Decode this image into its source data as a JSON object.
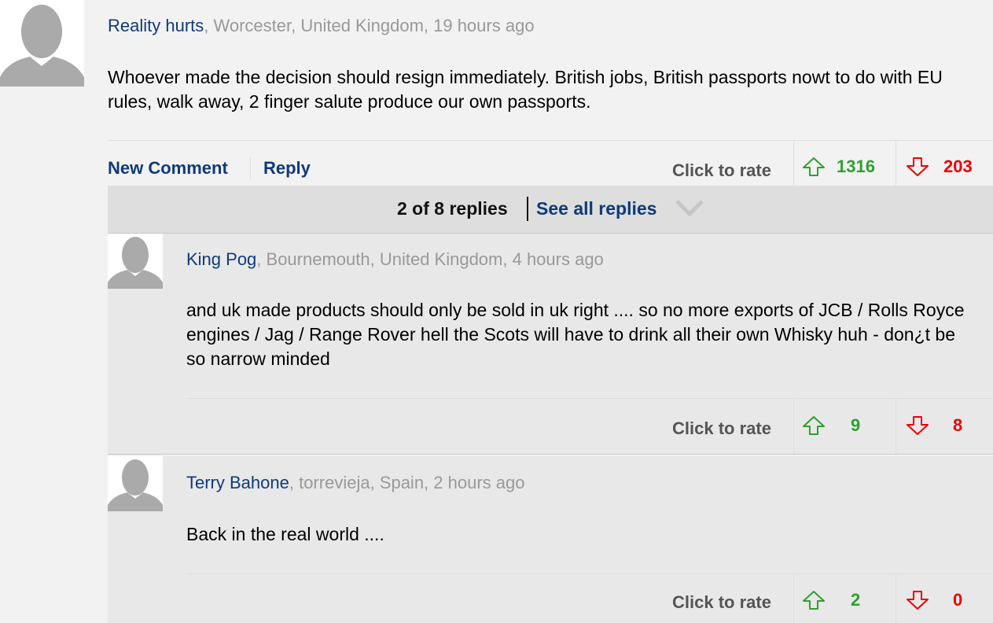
{
  "comment": {
    "author": "Reality hurts",
    "meta": ", Worcester, United Kingdom, 19 hours ago",
    "text": "Whoever made the decision should resign immediately. British jobs, British passports nowt to do with EU rules, walk away, 2 finger salute produce our own passports.",
    "new_comment_label": "New Comment",
    "reply_label": "Reply",
    "click_to_rate": "Click to rate",
    "up_votes": "1316",
    "down_votes": "203"
  },
  "replies_bar": {
    "count_label": "2 of 8 replies",
    "see_all_label": "See all replies"
  },
  "replies": [
    {
      "author": "King Pog",
      "meta": ", Bournemouth, United Kingdom, 4 hours ago",
      "text": "and uk made products should only be sold in uk right .... so no more exports of JCB / Rolls Royce engines / Jag / Range Rover hell the Scots will have to drink all their own Whisky huh - don¿t be so narrow minded",
      "click_to_rate": "Click to rate",
      "up_votes": "9",
      "down_votes": "8"
    },
    {
      "author": "Terry Bahone",
      "meta": ", torrevieja, Spain, 2 hours ago",
      "text": "Back in the real world ....",
      "click_to_rate": "Click to rate",
      "up_votes": "2",
      "down_votes": "0"
    }
  ],
  "colors": {
    "author_link": "#0f3a7a",
    "up_vote": "#2ea02e",
    "down_vote": "#e00000",
    "meta_text": "#999999"
  },
  "icons": [
    "avatar-placeholder-icon",
    "up-arrow-icon",
    "down-arrow-icon",
    "chevron-down-icon"
  ]
}
